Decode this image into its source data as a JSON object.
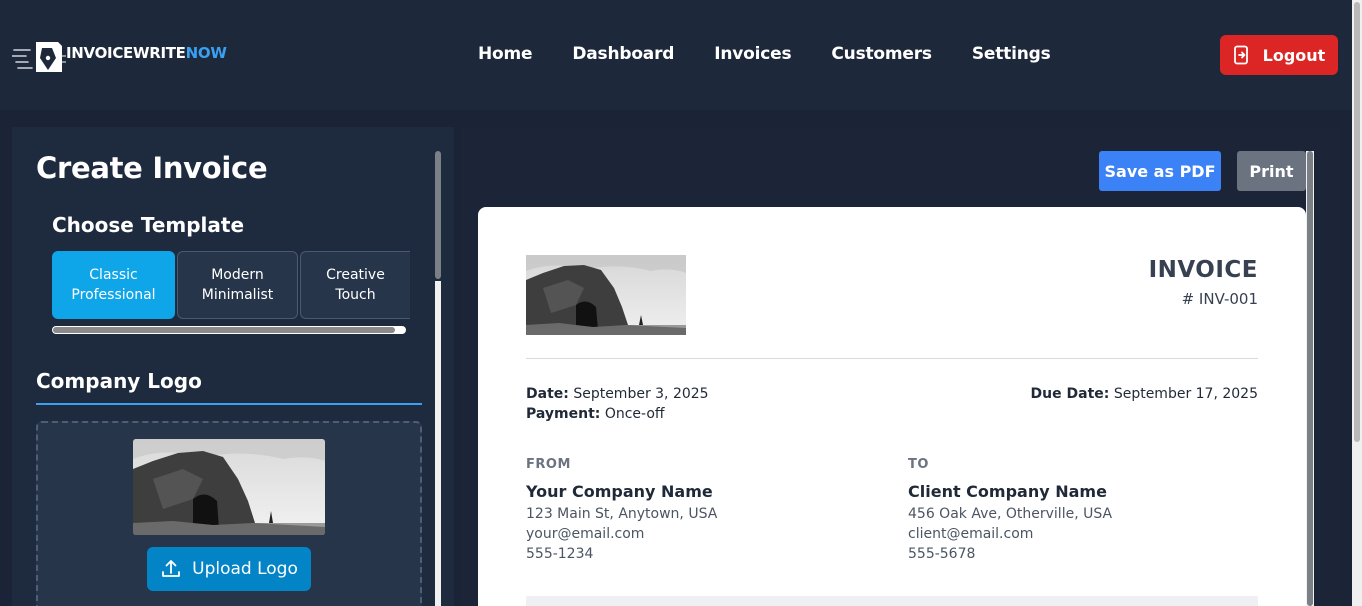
{
  "header": {
    "logo_word": "INVOICEWRITE",
    "logo_accent": "NOW",
    "nav": [
      "Home",
      "Dashboard",
      "Invoices",
      "Customers",
      "Settings"
    ],
    "logout_label": "Logout"
  },
  "editor": {
    "title": "Create Invoice",
    "template_heading": "Choose Template",
    "templates": [
      {
        "line1": "Classic",
        "line2": "Professional",
        "active": true
      },
      {
        "line1": "Modern",
        "line2": "Minimalist",
        "active": false
      },
      {
        "line1": "Creative",
        "line2": "Touch",
        "active": false
      }
    ],
    "logo_heading": "Company Logo",
    "upload_label": "Upload Logo"
  },
  "actions": {
    "pdf_label": "Save as PDF",
    "print_label": "Print"
  },
  "invoice": {
    "title": "INVOICE",
    "number": "# INV-001",
    "date_label": "Date:",
    "date": "September 3, 2025",
    "payment_label": "Payment:",
    "payment": "Once-off",
    "due_label": "Due Date:",
    "due": "September 17, 2025",
    "from": {
      "label": "FROM",
      "name": "Your Company Name",
      "address": "123 Main St, Anytown, USA",
      "email": "your@email.com",
      "phone": "555-1234"
    },
    "to": {
      "label": "TO",
      "name": "Client Company Name",
      "address": "456 Oak Ave, Otherville, USA",
      "email": "client@email.com",
      "phone": "555-5678"
    }
  },
  "colors": {
    "accent": "#3aa0f0",
    "logout": "#dc2626",
    "active_template": "#0ea5e9",
    "pdf_button": "#3b82f6",
    "print_button": "#6b7280"
  }
}
